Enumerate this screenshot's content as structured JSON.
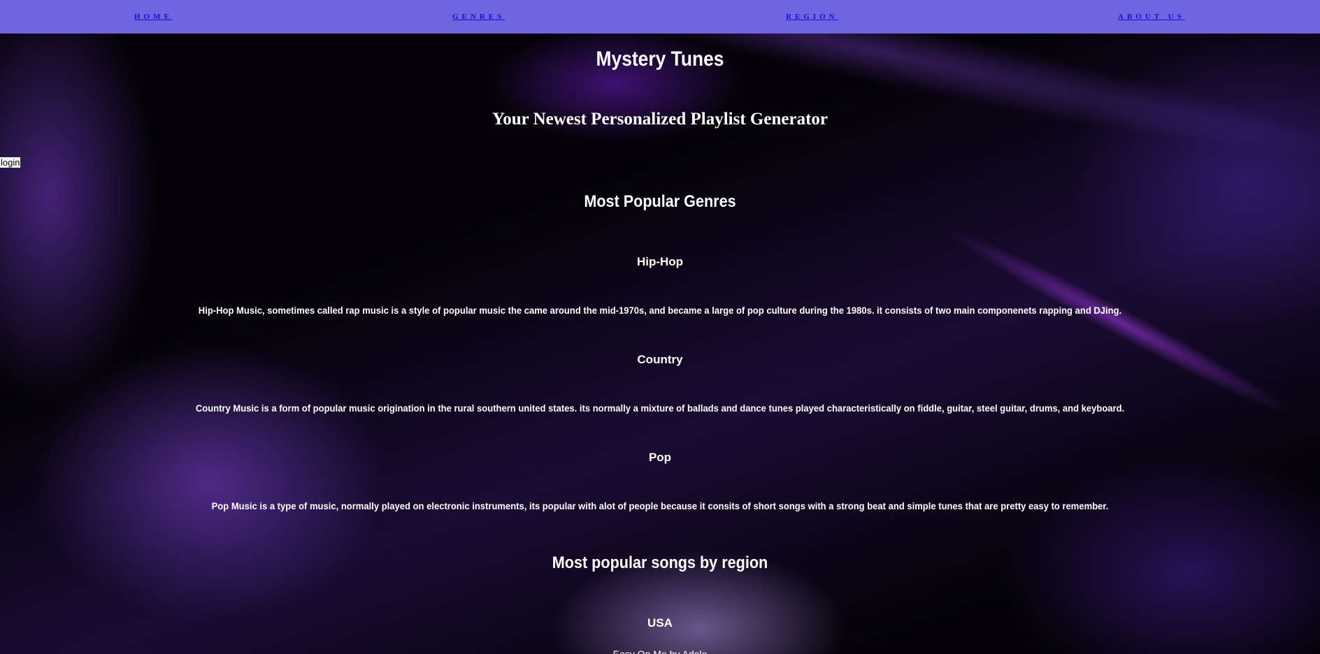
{
  "nav": {
    "items": [
      {
        "label": "HOME"
      },
      {
        "label": "GENRES"
      },
      {
        "label": "REGION"
      },
      {
        "label": "ABOUT US"
      }
    ]
  },
  "login": {
    "label": "login"
  },
  "header": {
    "title": "Mystery Tunes",
    "subtitle": "Your Newest Personalized Playlist Generator"
  },
  "genres": {
    "heading": "Most Popular Genres",
    "items": [
      {
        "name": "Hip-Hop",
        "description": "Hip-Hop Music, sometimes called rap music is a style of popular music the came around the mid-1970s, and became a large of pop culture during the 1980s. it consists of two main componenets rapping and DJing."
      },
      {
        "name": "Country",
        "description": "Country Music is a form of popular music origination in the rural southern united states. its normally a mixture of ballads and dance tunes played characteristically on fiddle, guitar, steel guitar, drums, and keyboard."
      },
      {
        "name": "Pop",
        "description": "Pop Music is a type of music, normally played on electronic instruments, its popular with alot of people because it consits of short songs with a strong beat and simple tunes that are pretty easy to remember."
      }
    ]
  },
  "regions": {
    "heading": "Most popular songs by region",
    "items": [
      {
        "name": "USA",
        "song": "Easy On Me by Adele"
      }
    ]
  }
}
